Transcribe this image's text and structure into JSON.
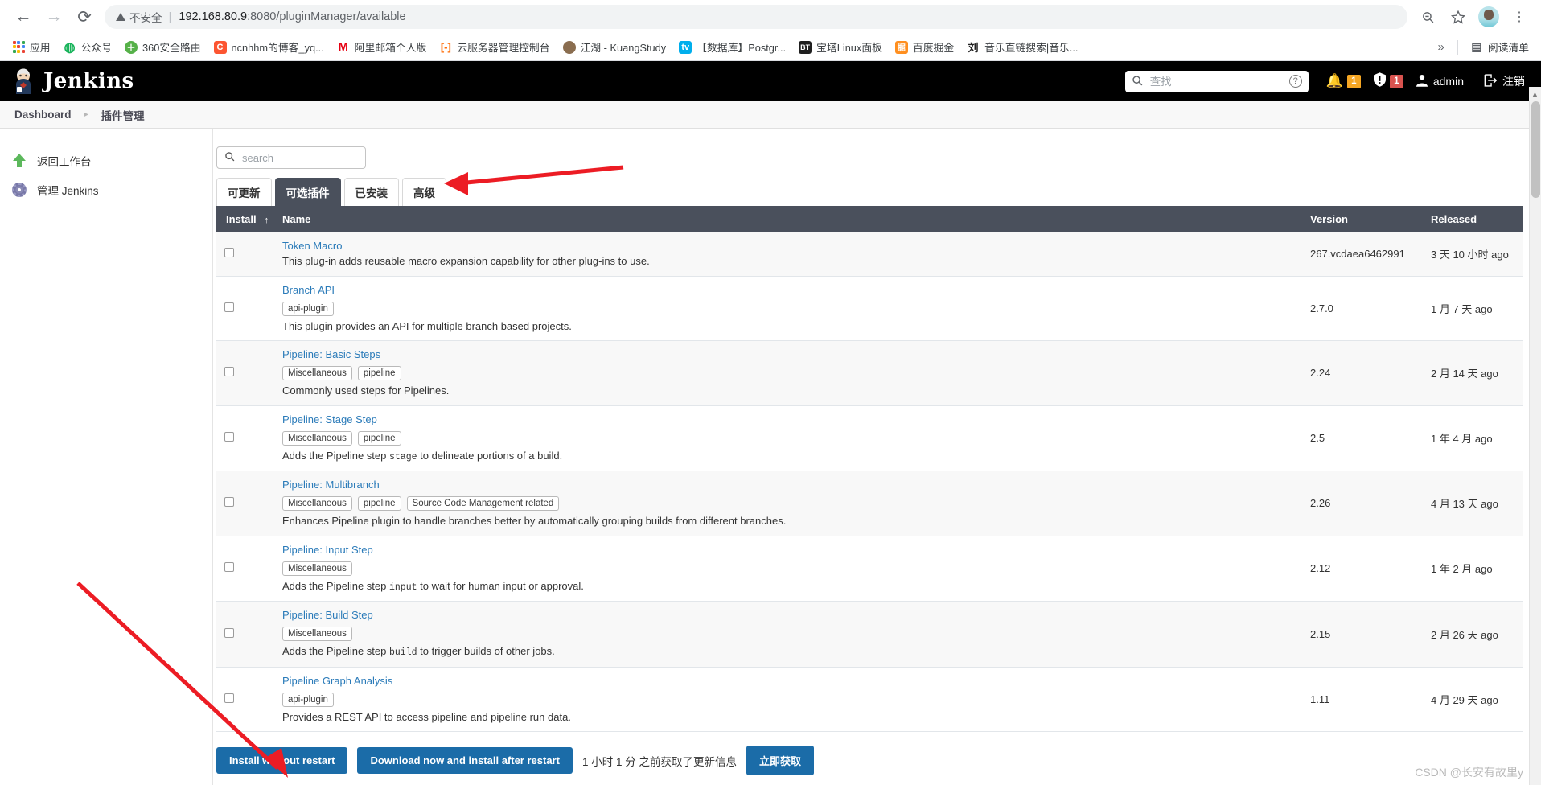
{
  "browser": {
    "back_icon": "back-arrow-icon",
    "forward_icon": "forward-arrow-icon",
    "reload_icon": "reload-icon",
    "security_label": "不安全",
    "url_host": "192.168.80.9",
    "url_rest": ":8080/pluginManager/available",
    "zoom_out_icon": "zoom-out-icon",
    "bookmark_star_icon": "star-icon",
    "profile_icon": "profile-avatar",
    "menu_icon": "three-dot-menu-icon",
    "bookmarks": [
      {
        "label": "应用",
        "icon": "apps-grid-icon",
        "color": "#4285f4"
      },
      {
        "label": "公众号",
        "icon": "wechat-icon",
        "color": "#18b35a"
      },
      {
        "label": "360安全路由",
        "icon": "360-icon",
        "color": "#56b149"
      },
      {
        "label": "ncnhhm的博客_yq...",
        "icon": "csdn-icon",
        "color": "#fc5531"
      },
      {
        "label": "阿里邮箱个人版",
        "icon": "mail-icon",
        "color": "#e60012"
      },
      {
        "label": "云服务器管理控制台",
        "icon": "cloud-console-icon",
        "color": "#ff6a00"
      },
      {
        "label": "江湖 - KuangStudy",
        "icon": "kuangstudy-icon",
        "color": "#8a6d4f"
      },
      {
        "label": "【数据库】Postgr...",
        "icon": "bilibili-icon",
        "color": "#00aeec"
      },
      {
        "label": "宝塔Linux面板",
        "icon": "bt-panel-icon",
        "color": "#1f1f1f"
      },
      {
        "label": "百度掘金",
        "icon": "juejin-icon",
        "color": "#ff8f1f"
      },
      {
        "label": "音乐直链搜索|音乐...",
        "icon": "music-icon",
        "color": "#3c4043"
      }
    ],
    "overflow_label": "»",
    "reading_list_label": "阅读清单",
    "reading_list_icon": "reading-list-icon"
  },
  "jenkins": {
    "brand": "Jenkins",
    "logo_icon": "jenkins-butler-icon",
    "search": {
      "placeholder": "查找",
      "search_icon": "search-icon",
      "help_icon": "help-circle-icon"
    },
    "notification": {
      "icon": "bell-icon",
      "count": "1",
      "color": "#f5a623"
    },
    "security": {
      "icon": "shield-exclamation-icon",
      "count": "1",
      "color": "#d9534f"
    },
    "user": {
      "icon": "person-icon",
      "label": "admin"
    },
    "logout": {
      "icon": "logout-icon",
      "label": "注销"
    }
  },
  "breadcrumb": {
    "items": [
      "Dashboard",
      "插件管理"
    ],
    "separator": "▸"
  },
  "sidebar": {
    "items": [
      {
        "label": "返回工作台",
        "icon": "green-up-arrow-icon"
      },
      {
        "label": "管理 Jenkins",
        "icon": "gear-icon"
      }
    ]
  },
  "main": {
    "search": {
      "placeholder": "search",
      "value": "",
      "icon": "search-icon"
    },
    "tabs": [
      {
        "label": "可更新",
        "active": false
      },
      {
        "label": "可选插件",
        "active": true
      },
      {
        "label": "已安装",
        "active": false
      },
      {
        "label": "高级",
        "active": false
      }
    ],
    "table": {
      "headers": {
        "install": "Install",
        "sort_arrow": "↑",
        "name": "Name",
        "version": "Version",
        "released": "Released"
      },
      "rows": [
        {
          "name": "Token Macro",
          "labels": [],
          "description": "This plug-in adds reusable macro expansion capability for other plug-ins to use.",
          "version": "267.vcdaea6462991",
          "released": "3 天 10 小时 ago",
          "checked": false
        },
        {
          "name": "Branch API",
          "labels": [
            "api-plugin"
          ],
          "description": "This plugin provides an API for multiple branch based projects.",
          "version": "2.7.0",
          "released": "1 月 7 天 ago",
          "checked": false
        },
        {
          "name": "Pipeline: Basic Steps",
          "labels": [
            "Miscellaneous",
            "pipeline"
          ],
          "description": "Commonly used steps for Pipelines.",
          "version": "2.24",
          "released": "2 月 14 天 ago",
          "checked": false
        },
        {
          "name": "Pipeline: Stage Step",
          "labels": [
            "Miscellaneous",
            "pipeline"
          ],
          "description_pre": "Adds the Pipeline step ",
          "description_code": "stage",
          "description_post": " to delineate portions of a build.",
          "description": "Adds the Pipeline step stage to delineate portions of a build.",
          "version": "2.5",
          "released": "1 年 4 月 ago",
          "checked": false
        },
        {
          "name": "Pipeline: Multibranch",
          "labels": [
            "Miscellaneous",
            "pipeline",
            "Source Code Management related"
          ],
          "description": "Enhances Pipeline plugin to handle branches better by automatically grouping builds from different branches.",
          "version": "2.26",
          "released": "4 月 13 天 ago",
          "checked": false
        },
        {
          "name": "Pipeline: Input Step",
          "labels": [
            "Miscellaneous"
          ],
          "description_pre": "Adds the Pipeline step ",
          "description_code": "input",
          "description_post": " to wait for human input or approval.",
          "description": "Adds the Pipeline step input to wait for human input or approval.",
          "version": "2.12",
          "released": "1 年 2 月 ago",
          "checked": false
        },
        {
          "name": "Pipeline: Build Step",
          "labels": [
            "Miscellaneous"
          ],
          "description_pre": "Adds the Pipeline step ",
          "description_code": "build",
          "description_post": " to trigger builds of other jobs.",
          "description": "Adds the Pipeline step build to trigger builds of other jobs.",
          "version": "2.15",
          "released": "2 月 26 天 ago",
          "checked": false
        },
        {
          "name": "Pipeline Graph Analysis",
          "labels": [
            "api-plugin"
          ],
          "description": "Provides a REST API to access pipeline and pipeline run data.",
          "version": "1.11",
          "released": "4 月 29 天 ago",
          "checked": false
        }
      ]
    },
    "footer": {
      "install_without_restart": "Install without restart",
      "download_install_after_restart": "Download now and install after restart",
      "update_note": "1 小时 1 分 之前获取了更新信息",
      "check_now": "立即获取",
      "primary_color": "#1b6ca8"
    }
  },
  "watermark": "CSDN @长安有故里y"
}
